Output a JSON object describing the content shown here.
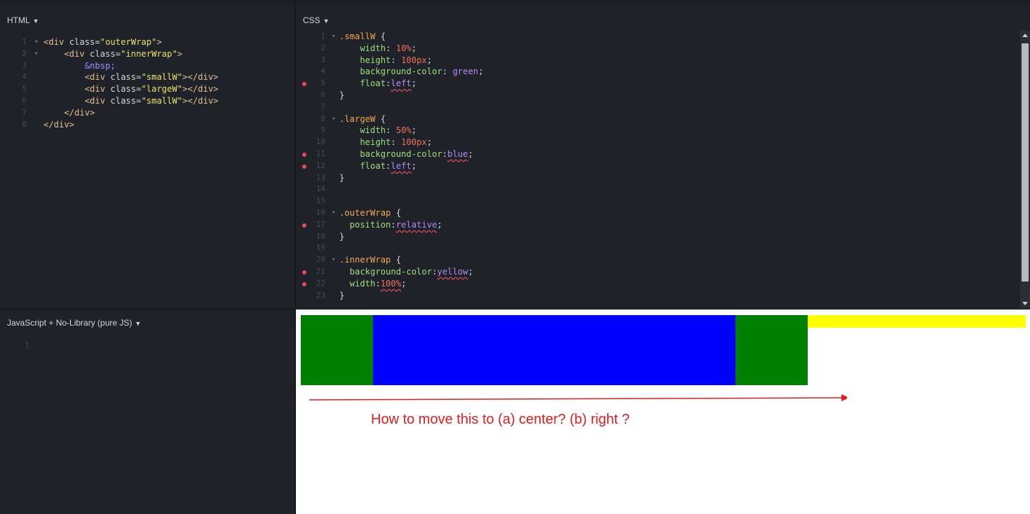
{
  "panels": {
    "html_title": "HTML",
    "css_title": "CSS",
    "js_title": "JavaScript + No-Library (pure JS)",
    "caret": "▼"
  },
  "html_editor": {
    "lines": [
      {
        "n": "1",
        "fold": true,
        "code": [
          {
            "t": "<div",
            "c": "tag"
          },
          {
            "t": " class=",
            "c": "attr"
          },
          {
            "t": "\"outerWrap\"",
            "c": "str"
          },
          {
            "t": ">",
            "c": "tag"
          }
        ]
      },
      {
        "n": "2",
        "fold": true,
        "code": [
          {
            "t": "    <div",
            "c": "tag"
          },
          {
            "t": " class=",
            "c": "attr"
          },
          {
            "t": "\"innerWrap\"",
            "c": "str"
          },
          {
            "t": ">",
            "c": "tag"
          }
        ]
      },
      {
        "n": "3",
        "fold": false,
        "code": [
          {
            "t": "        &nbsp;",
            "c": "ent"
          }
        ]
      },
      {
        "n": "4",
        "fold": false,
        "code": [
          {
            "t": "        <div",
            "c": "tag"
          },
          {
            "t": " class=",
            "c": "attr"
          },
          {
            "t": "\"smallW\"",
            "c": "str"
          },
          {
            "t": "></div>",
            "c": "tag"
          }
        ]
      },
      {
        "n": "5",
        "fold": false,
        "code": [
          {
            "t": "        <div",
            "c": "tag"
          },
          {
            "t": " class=",
            "c": "attr"
          },
          {
            "t": "\"largeW\"",
            "c": "str"
          },
          {
            "t": "></div>",
            "c": "tag"
          }
        ]
      },
      {
        "n": "6",
        "fold": false,
        "code": [
          {
            "t": "        <div",
            "c": "tag"
          },
          {
            "t": " class=",
            "c": "attr"
          },
          {
            "t": "\"smallW\"",
            "c": "str"
          },
          {
            "t": "></div>",
            "c": "tag"
          }
        ]
      },
      {
        "n": "7",
        "fold": false,
        "code": [
          {
            "t": "    </div>",
            "c": "tag"
          }
        ]
      },
      {
        "n": "8",
        "fold": false,
        "code": [
          {
            "t": "</div>",
            "c": "tag"
          }
        ]
      }
    ]
  },
  "css_editor": {
    "lines": [
      {
        "n": "1",
        "fold": true,
        "err": false,
        "code": [
          {
            "t": ".smallW",
            "c": "sel"
          },
          {
            "t": " {",
            "c": "pl"
          }
        ]
      },
      {
        "n": "2",
        "fold": false,
        "err": false,
        "code": [
          {
            "t": "    width",
            "c": "prop"
          },
          {
            "t": ": ",
            "c": "pl"
          },
          {
            "t": "10%",
            "c": "num"
          },
          {
            "t": ";",
            "c": "pl"
          }
        ]
      },
      {
        "n": "3",
        "fold": false,
        "err": false,
        "code": [
          {
            "t": "    height",
            "c": "prop"
          },
          {
            "t": ": ",
            "c": "pl"
          },
          {
            "t": "100px",
            "c": "num"
          },
          {
            "t": ";",
            "c": "pl"
          }
        ]
      },
      {
        "n": "4",
        "fold": false,
        "err": false,
        "code": [
          {
            "t": "    background-color",
            "c": "prop"
          },
          {
            "t": ": ",
            "c": "pl"
          },
          {
            "t": "green",
            "c": "kw"
          },
          {
            "t": ";",
            "c": "pl"
          }
        ]
      },
      {
        "n": "5",
        "fold": false,
        "err": true,
        "code": [
          {
            "t": "    float",
            "c": "prop"
          },
          {
            "t": ":",
            "c": "pl"
          },
          {
            "t": "left",
            "c": "kw sq"
          },
          {
            "t": ";",
            "c": "pl"
          }
        ]
      },
      {
        "n": "6",
        "fold": false,
        "err": false,
        "code": [
          {
            "t": "}",
            "c": "pl"
          }
        ]
      },
      {
        "n": "7",
        "fold": false,
        "err": false,
        "code": []
      },
      {
        "n": "8",
        "fold": true,
        "err": false,
        "code": [
          {
            "t": ".largeW",
            "c": "sel"
          },
          {
            "t": " {",
            "c": "pl"
          }
        ]
      },
      {
        "n": "9",
        "fold": false,
        "err": false,
        "code": [
          {
            "t": "    width",
            "c": "prop"
          },
          {
            "t": ": ",
            "c": "pl"
          },
          {
            "t": "50%",
            "c": "num"
          },
          {
            "t": ";",
            "c": "pl"
          }
        ]
      },
      {
        "n": "10",
        "fold": false,
        "err": false,
        "code": [
          {
            "t": "    height",
            "c": "prop"
          },
          {
            "t": ": ",
            "c": "pl"
          },
          {
            "t": "100px",
            "c": "num"
          },
          {
            "t": ";",
            "c": "pl"
          }
        ]
      },
      {
        "n": "11",
        "fold": false,
        "err": true,
        "code": [
          {
            "t": "    background-color",
            "c": "prop"
          },
          {
            "t": ":",
            "c": "pl"
          },
          {
            "t": "blue",
            "c": "kw sq"
          },
          {
            "t": ";",
            "c": "pl"
          }
        ]
      },
      {
        "n": "12",
        "fold": false,
        "err": true,
        "code": [
          {
            "t": "    float",
            "c": "prop"
          },
          {
            "t": ":",
            "c": "pl"
          },
          {
            "t": "left",
            "c": "kw sq"
          },
          {
            "t": ";",
            "c": "pl"
          }
        ]
      },
      {
        "n": "13",
        "fold": false,
        "err": false,
        "code": [
          {
            "t": "}",
            "c": "pl"
          }
        ]
      },
      {
        "n": "14",
        "fold": false,
        "err": false,
        "code": []
      },
      {
        "n": "15",
        "fold": false,
        "err": false,
        "code": []
      },
      {
        "n": "16",
        "fold": true,
        "err": false,
        "code": [
          {
            "t": ".outerWrap",
            "c": "sel"
          },
          {
            "t": " {",
            "c": "pl"
          }
        ]
      },
      {
        "n": "17",
        "fold": false,
        "err": true,
        "code": [
          {
            "t": "  position",
            "c": "prop"
          },
          {
            "t": ":",
            "c": "pl"
          },
          {
            "t": "relative",
            "c": "kw sq"
          },
          {
            "t": ";",
            "c": "pl"
          }
        ]
      },
      {
        "n": "18",
        "fold": false,
        "err": false,
        "code": [
          {
            "t": "}",
            "c": "pl"
          }
        ]
      },
      {
        "n": "19",
        "fold": false,
        "err": false,
        "code": []
      },
      {
        "n": "20",
        "fold": true,
        "err": false,
        "code": [
          {
            "t": ".innerWrap",
            "c": "sel"
          },
          {
            "t": " {",
            "c": "pl"
          }
        ]
      },
      {
        "n": "21",
        "fold": false,
        "err": true,
        "code": [
          {
            "t": "  background-color",
            "c": "prop"
          },
          {
            "t": ":",
            "c": "pl"
          },
          {
            "t": "yellow",
            "c": "kw sq"
          },
          {
            "t": ";",
            "c": "pl"
          }
        ]
      },
      {
        "n": "22",
        "fold": false,
        "err": true,
        "code": [
          {
            "t": "  width",
            "c": "prop"
          },
          {
            "t": ":",
            "c": "pl"
          },
          {
            "t": "100%",
            "c": "num sq"
          },
          {
            "t": ";",
            "c": "pl"
          }
        ]
      },
      {
        "n": "23",
        "fold": false,
        "err": false,
        "code": [
          {
            "t": "}",
            "c": "pl"
          }
        ]
      }
    ]
  },
  "js_editor": {
    "lines": [
      {
        "n": "1"
      }
    ]
  },
  "result": {
    "annotation": "How to move this to (a) center?  (b) right ?",
    "colors": {
      "small": "#008000",
      "large": "#0000ff",
      "inner": "#ffff00",
      "annotation": "#e01c1c"
    }
  }
}
